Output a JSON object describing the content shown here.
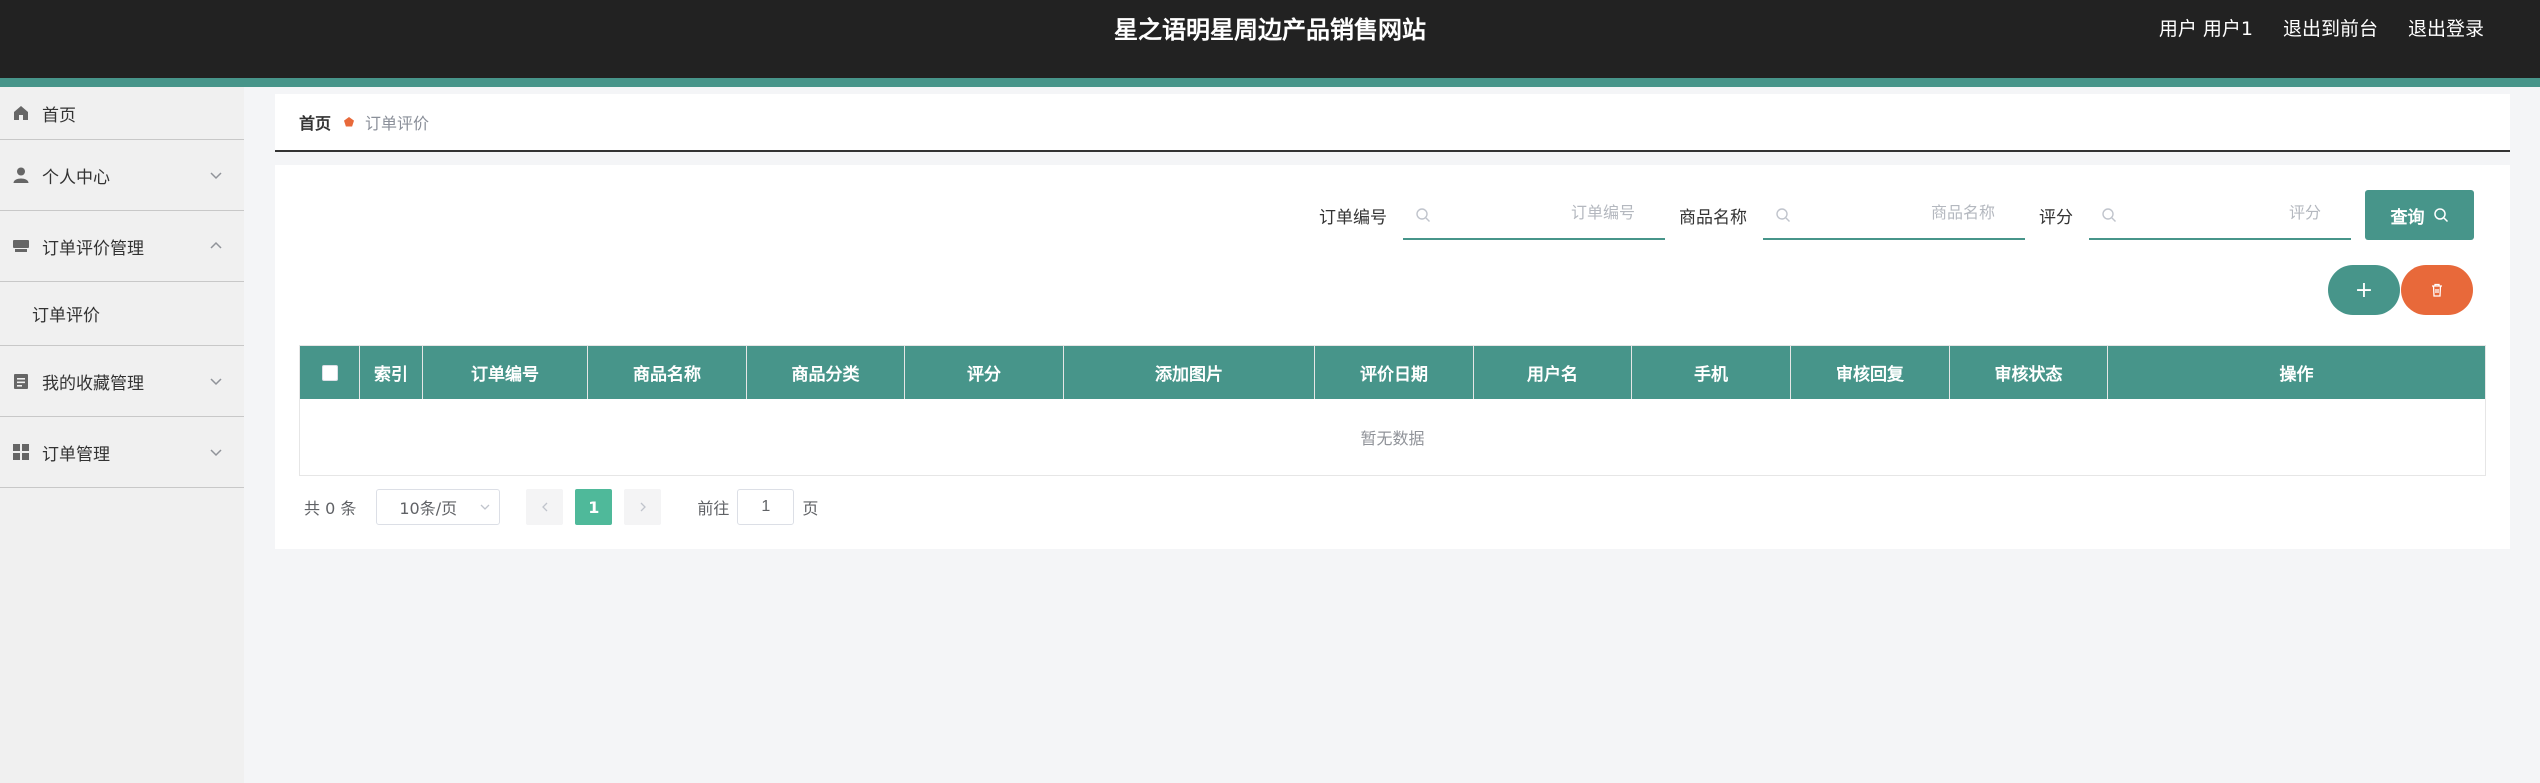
{
  "header": {
    "title": "星之语明星周边产品销售网站",
    "user_label": "用户",
    "user_name": "用户1",
    "back_front": "退出到前台",
    "logout": "退出登录"
  },
  "sidebar": {
    "items": [
      {
        "label": "首页",
        "icon": "home-icon"
      },
      {
        "label": "个人中心",
        "icon": "user-icon"
      },
      {
        "label": "订单评价管理",
        "icon": "box-icon"
      },
      {
        "label": "订单评价",
        "icon": ""
      },
      {
        "label": "我的收藏管理",
        "icon": "clipboard-icon"
      },
      {
        "label": "订单管理",
        "icon": "grid-icon"
      }
    ]
  },
  "breadcrumb": {
    "home": "首页",
    "current": "订单评价"
  },
  "search": {
    "order_no_label": "订单编号",
    "order_no_placeholder": "订单编号",
    "product_label": "商品名称",
    "product_placeholder": "商品名称",
    "rating_label": "评分",
    "rating_placeholder": "评分",
    "query_label": "查询"
  },
  "actions": {
    "add": "+"
  },
  "table": {
    "headers": [
      "索引",
      "订单编号",
      "商品名称",
      "商品分类",
      "评分",
      "添加图片",
      "评价日期",
      "用户名",
      "手机",
      "审核回复",
      "审核状态",
      "操作"
    ],
    "empty_text": "暂无数据"
  },
  "pagination": {
    "total": "共 0 条",
    "page_size": "10条/页",
    "current_page": "1",
    "goto_label": "前往",
    "goto_value": "1",
    "page_suffix": "页"
  },
  "colors": {
    "accent": "#47958a",
    "danger": "#e8693a",
    "header_bg": "#222222"
  }
}
